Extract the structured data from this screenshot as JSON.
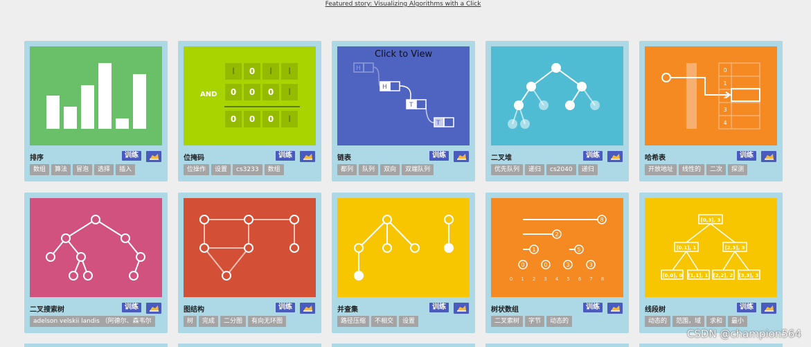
{
  "featured": "Featured story: Visualizing Algorithms with a Click",
  "train_label": "训练",
  "click_to_view": "Click to View",
  "watermark": "CSDN @champion564",
  "cards": [
    {
      "title": "排序",
      "color": "#6abf69",
      "tags": [
        "数组",
        "算法",
        "冒泡",
        "选择",
        "插入"
      ]
    },
    {
      "title": "位掩码",
      "color": "#aad400",
      "tags": [
        "位操作",
        "设置",
        "cs3233",
        "数组"
      ]
    },
    {
      "title": "链表",
      "color": "#4f63c1",
      "tags": [
        "都列",
        "队列",
        "双向",
        "双端队列"
      ]
    },
    {
      "title": "二叉堆",
      "color": "#4fbcd4",
      "tags": [
        "优先队列",
        "递归",
        "cs2040",
        "递归"
      ]
    },
    {
      "title": "哈希表",
      "color": "#f48a21",
      "tags": [
        "开放地址",
        "线性的",
        "二次",
        "探测"
      ]
    },
    {
      "title": "二叉搜索树",
      "color": "#d2527f",
      "tags": [
        "adelson velskii landis （阿德尔、森韦尔"
      ]
    },
    {
      "title": "图结构",
      "color": "#d35037",
      "tags": [
        "树",
        "完成",
        "二分图",
        "有向无环图"
      ]
    },
    {
      "title": "并查集",
      "color": "#f7c600",
      "tags": [
        "路径压缩",
        "不相交",
        "设置"
      ]
    },
    {
      "title": "树状数组",
      "color": "#f48a21",
      "tags": [
        "二叉索树",
        "字节",
        "动态的"
      ]
    },
    {
      "title": "线段树",
      "color": "#f7c600",
      "tags": [
        "动态的",
        "范围，域",
        "求和",
        "最小"
      ]
    }
  ],
  "thumbs": {
    "bitmask_label": "AND",
    "bitmask_rows": [
      [
        "l",
        "0",
        "l",
        "l"
      ],
      [
        "0",
        "0",
        "0",
        "l"
      ],
      [
        "0",
        "0",
        "0",
        "l"
      ]
    ],
    "linked_list_labels": [
      "H",
      "H",
      "T",
      "T"
    ],
    "hash_indices": [
      "0",
      "1",
      "2",
      "3",
      "4"
    ],
    "fenwick_nodes": [
      "8",
      "2",
      "1",
      "5",
      "0",
      "0",
      "3",
      "3"
    ],
    "fenwick_axis": [
      "0",
      "1",
      "2",
      "3",
      "4",
      "5",
      "6",
      "7",
      "8"
    ],
    "segtree_labels": [
      "[0,3], 3",
      "[0,1], 1",
      "[2,3], 3",
      "[0,0], 0",
      "[1,1], 1",
      "[2,2], 2",
      "[3,3], 3"
    ]
  },
  "icons": {
    "train": "train-badge",
    "hand": "hand-pointer-icon"
  }
}
